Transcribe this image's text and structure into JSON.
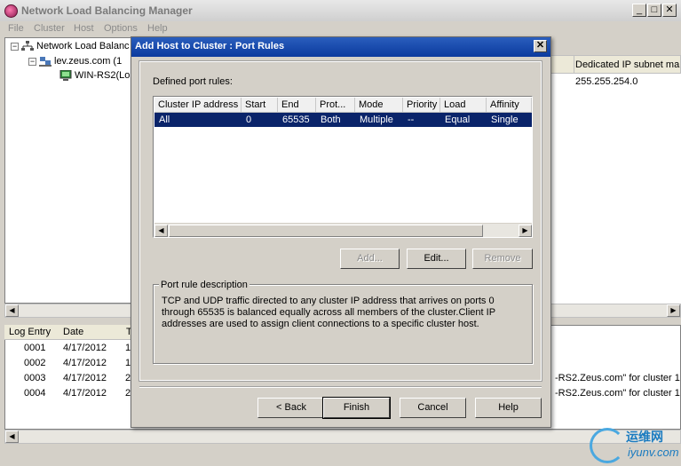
{
  "main_window": {
    "title": "Network Load Balancing Manager",
    "controls": {
      "minimize": "_",
      "maximize": "□",
      "close": "✕"
    },
    "menu": [
      "File",
      "Cluster",
      "Host",
      "Options",
      "Help"
    ],
    "tree": {
      "root": "Network Load Balanc",
      "cluster": "lev.zeus.com (1",
      "host": "WIN-RS2(Lo"
    },
    "right_pane": {
      "header": "Dedicated IP subnet ma",
      "value": "255.255.254.0"
    },
    "log": {
      "columns": [
        "Log Entry",
        "Date",
        "T"
      ],
      "rows": [
        {
          "entry": "0001",
          "date": "4/17/2012",
          "t": "1",
          "tail": ""
        },
        {
          "entry": "0002",
          "date": "4/17/2012",
          "t": "1",
          "tail": ""
        },
        {
          "entry": "0003",
          "date": "4/17/2012",
          "t": "2",
          "tail": "-RS2.Zeus.com\" for cluster 1"
        },
        {
          "entry": "0004",
          "date": "4/17/2012",
          "t": "2",
          "tail": "-RS2.Zeus.com\" for cluster 1"
        }
      ]
    }
  },
  "dialog": {
    "title": "Add Host to Cluster : Port Rules",
    "close_label": "✕",
    "defined_rules_label": "Defined port rules:",
    "columns": [
      "Cluster IP address",
      "Start",
      "End",
      "Prot...",
      "Mode",
      "Priority",
      "Load",
      "Affinity"
    ],
    "rules": [
      {
        "ip": "All",
        "start": "0",
        "end": "65535",
        "protocol": "Both",
        "mode": "Multiple",
        "priority": "--",
        "load": "Equal",
        "affinity": "Single"
      }
    ],
    "buttons": {
      "add": "Add...",
      "edit": "Edit...",
      "remove": "Remove",
      "back": "< Back",
      "finish": "Finish",
      "cancel": "Cancel",
      "help": "Help"
    },
    "description_title": "Port rule description",
    "description_text": "TCP and UDP traffic directed to any cluster IP address that arrives on ports 0 through 65535 is balanced equally across all members of the cluster.Client IP addresses are used to assign client connections to a specific cluster host."
  },
  "watermark": {
    "cn": "运维网",
    "en": "iyunv.com"
  }
}
